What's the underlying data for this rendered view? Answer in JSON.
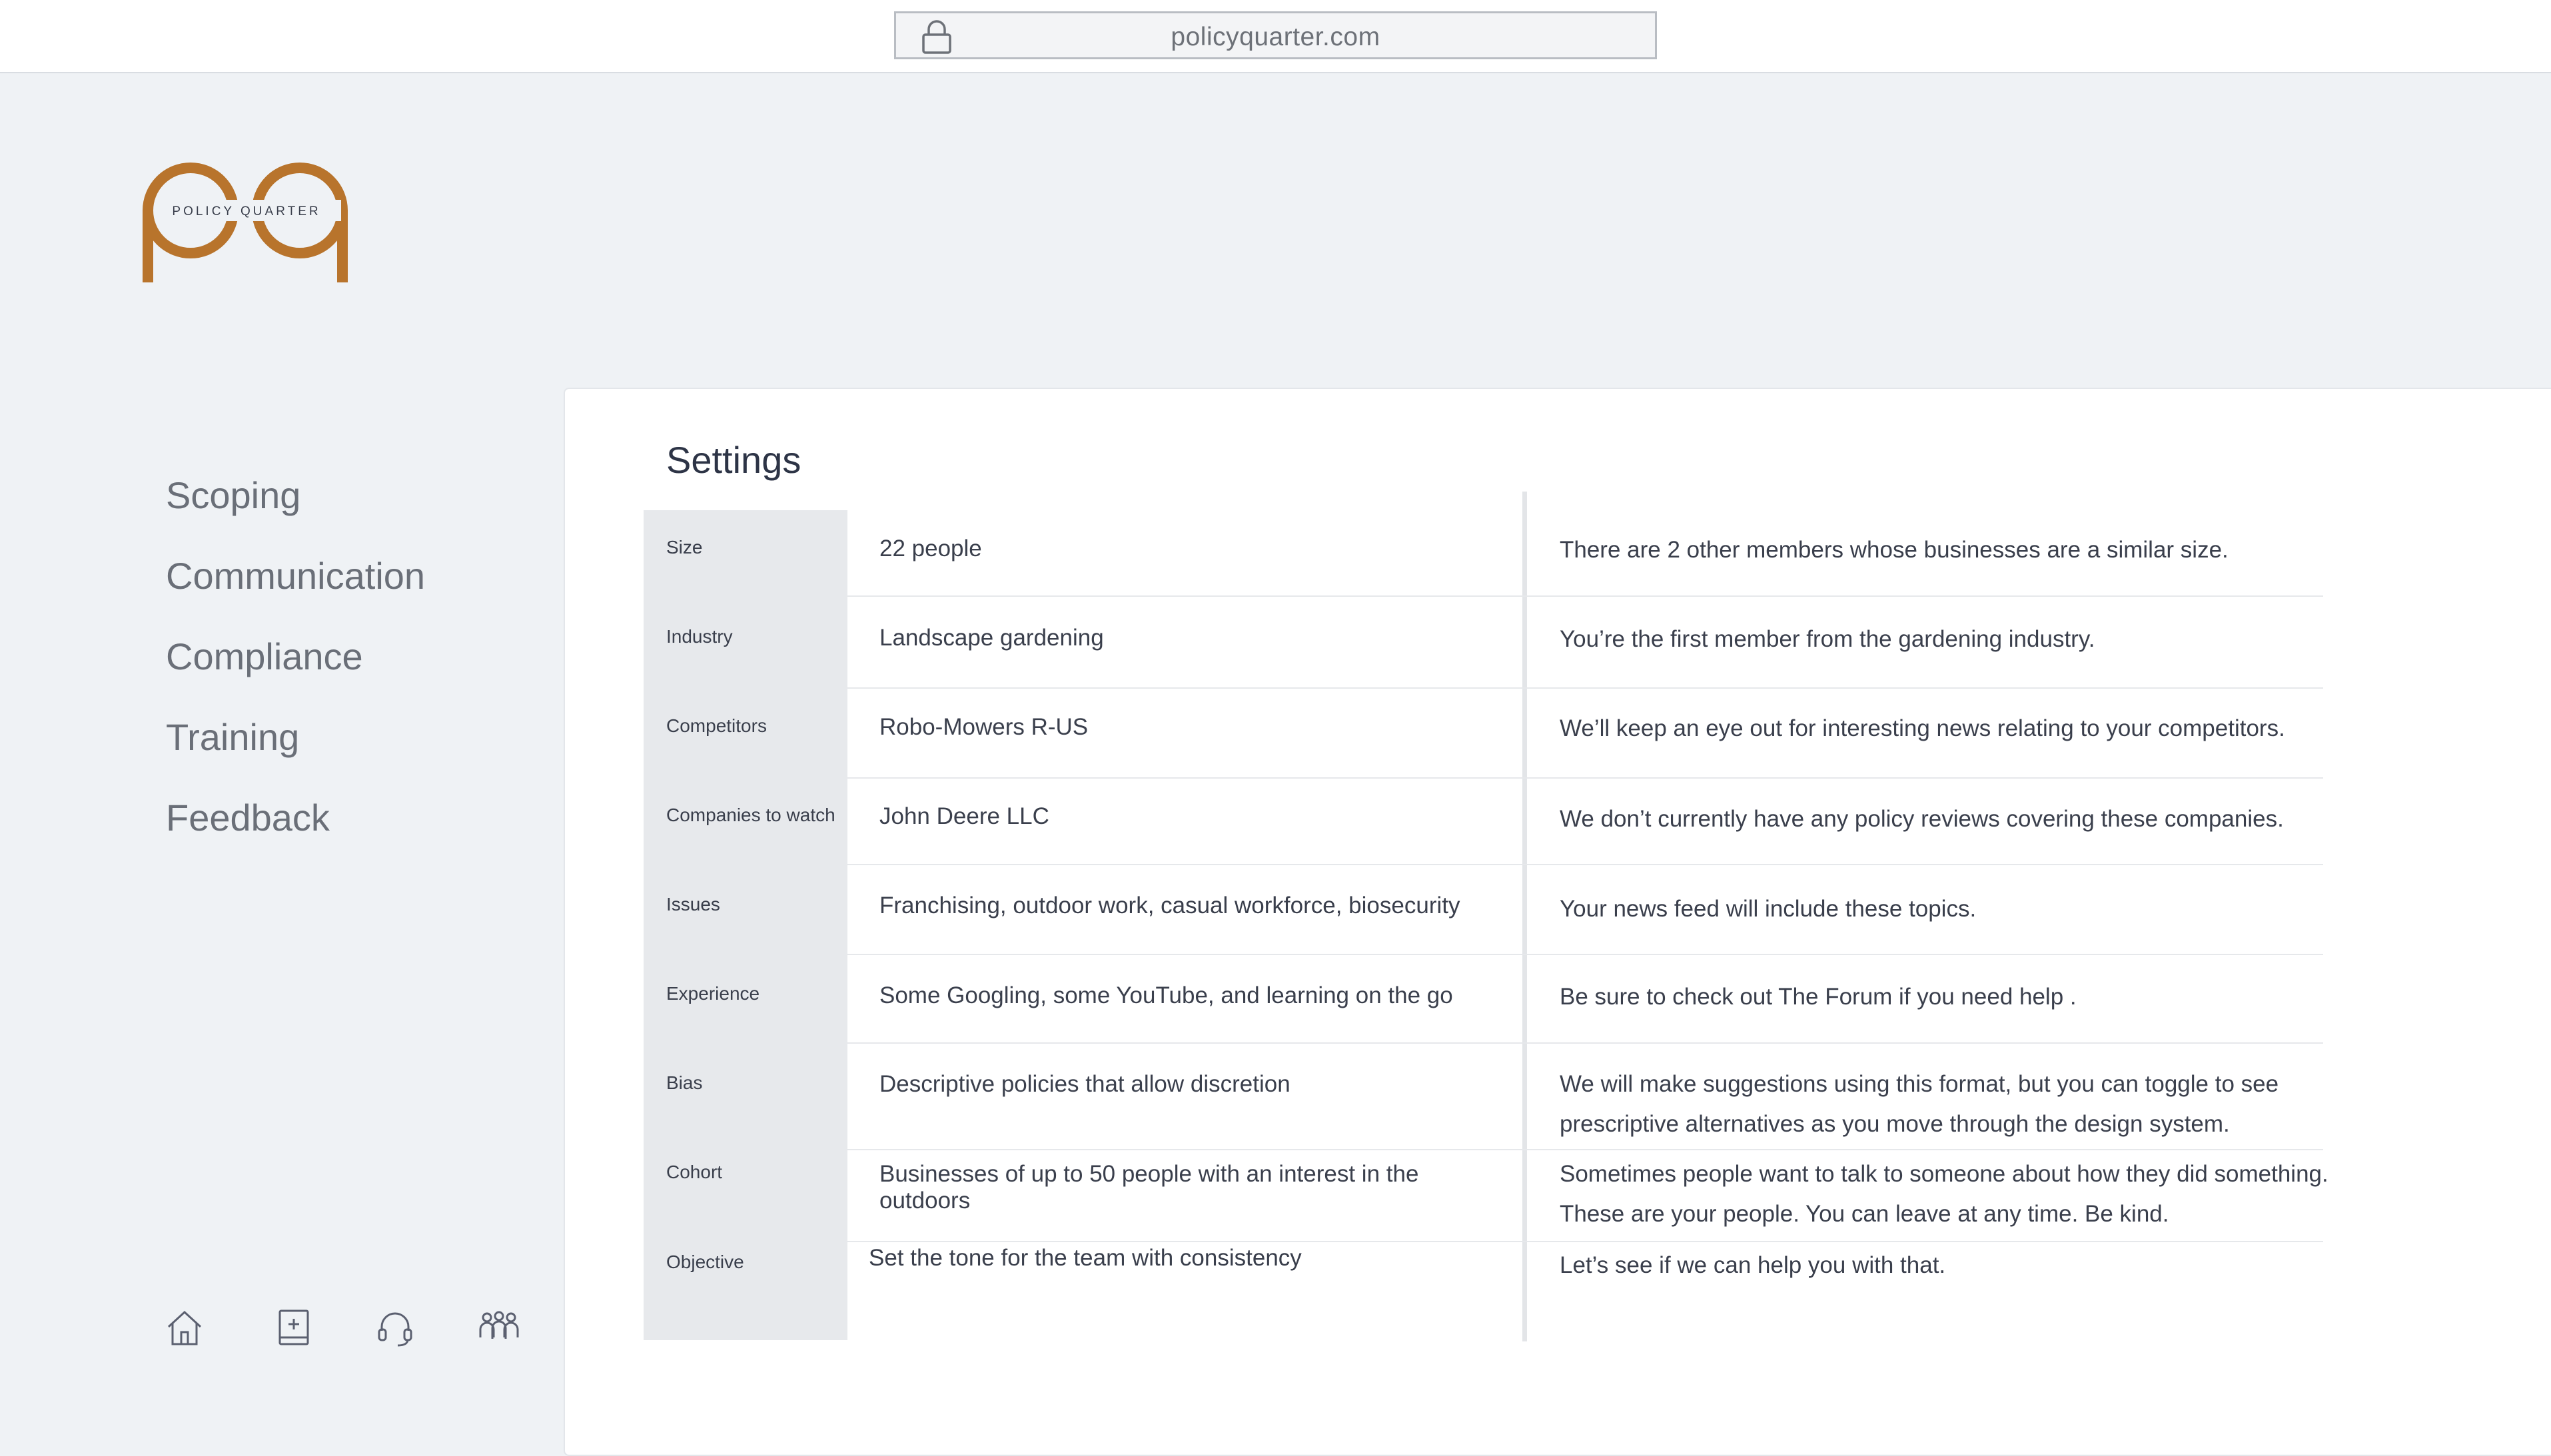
{
  "browser": {
    "url": "policyquarter.com",
    "lock_icon": "lock-icon"
  },
  "logo": {
    "text": "POLICY QUARTER",
    "letters": "pq",
    "color": "#b8742c"
  },
  "nav": {
    "items": [
      {
        "label": "Scoping"
      },
      {
        "label": "Communication"
      },
      {
        "label": "Compliance"
      },
      {
        "label": "Training"
      },
      {
        "label": "Feedback"
      }
    ]
  },
  "bottom_icons": [
    "home-icon",
    "add-notebook-icon",
    "headset-icon",
    "group-icon"
  ],
  "settings": {
    "title": "Settings",
    "rows": [
      {
        "label": "Size",
        "value": "22 people",
        "note": "There are 2 other members whose businesses are a similar size."
      },
      {
        "label": "Industry",
        "value": "Landscape gardening",
        "note": "You’re the first member from the gardening industry."
      },
      {
        "label": "Competitors",
        "value": "Robo-Mowers R-US",
        "note": "We’ll keep an eye out for interesting news relating to your competitors."
      },
      {
        "label": "Companies to watch",
        "value": "John Deere LLC",
        "note": "We don’t currently have any policy reviews covering these companies."
      },
      {
        "label": "Issues",
        "value": "Franchising, outdoor work, casual workforce, biosecurity",
        "note": "Your news feed will include these topics."
      },
      {
        "label": "Experience",
        "value": "Some Googling, some YouTube, and learning on the go",
        "note": "Be sure to check out The Forum if you need help ."
      },
      {
        "label": "Bias",
        "value": "Descriptive policies that allow discretion",
        "note": "We will make suggestions using this format, but you can toggle to see prescriptive alternatives as you move through the design system."
      },
      {
        "label": "Cohort",
        "value": "Businesses of up to 50 people with an interest in the outdoors",
        "note": "Sometimes people want to talk to someone about how they did something. These are your people. You can leave at any time. Be kind."
      },
      {
        "label": "Objective",
        "value": "Set the tone for the team with consistency",
        "note": "Let’s see if we can help you with that."
      }
    ]
  }
}
